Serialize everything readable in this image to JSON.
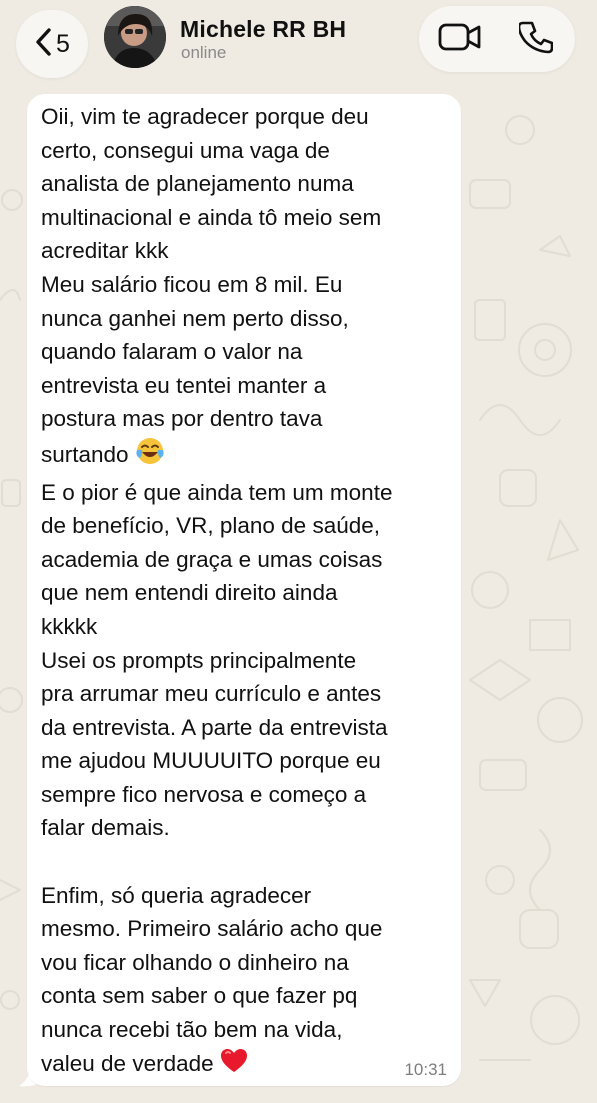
{
  "header": {
    "back_badge": "5",
    "contact_name": "Michele RR BH",
    "contact_status": "online",
    "icons": {
      "back": "chevron-left-icon",
      "video": "video-camera-icon",
      "call": "phone-icon"
    }
  },
  "message": {
    "lines": [
      "Oii, vim te agradecer porque deu",
      "certo, consegui uma vaga de",
      "analista de planejamento numa",
      "multinacional e ainda tô meio sem",
      "acreditar kkk",
      "Meu salário ficou em 8 mil. Eu",
      "nunca ganhei nem perto disso,",
      "quando falaram o valor na",
      "entrevista eu tentei manter a",
      "postura mas por dentro tava",
      "surtando",
      "E o pior é que ainda tem um monte",
      "de benefício, VR, plano de saúde,",
      "academia de graça e umas coisas",
      "que nem entendi direito ainda",
      "kkkkk",
      "Usei os prompts principalmente",
      "pra arrumar meu currículo e antes",
      "da entrevista. A parte da entrevista",
      "me ajudou MUUUUITO porque eu",
      "sempre fico nervosa e começo a",
      "falar demais.",
      "",
      "Enfim, só queria agradecer",
      "mesmo. Primeiro salário acho que",
      "vou ficar olhando o dinheiro na",
      "conta sem saber o que fazer pq",
      "nunca recebi tão bem na vida,",
      "valeu de verdade"
    ],
    "emoji_1": "laughing-tears-emoji",
    "emoji_2": "red-heart-emoji",
    "time": "10:31"
  },
  "colors": {
    "background": "#efeae2",
    "bubble": "#ffffff",
    "pill": "#f7f6f3",
    "text": "#111111",
    "muted": "#8a8a8a"
  }
}
